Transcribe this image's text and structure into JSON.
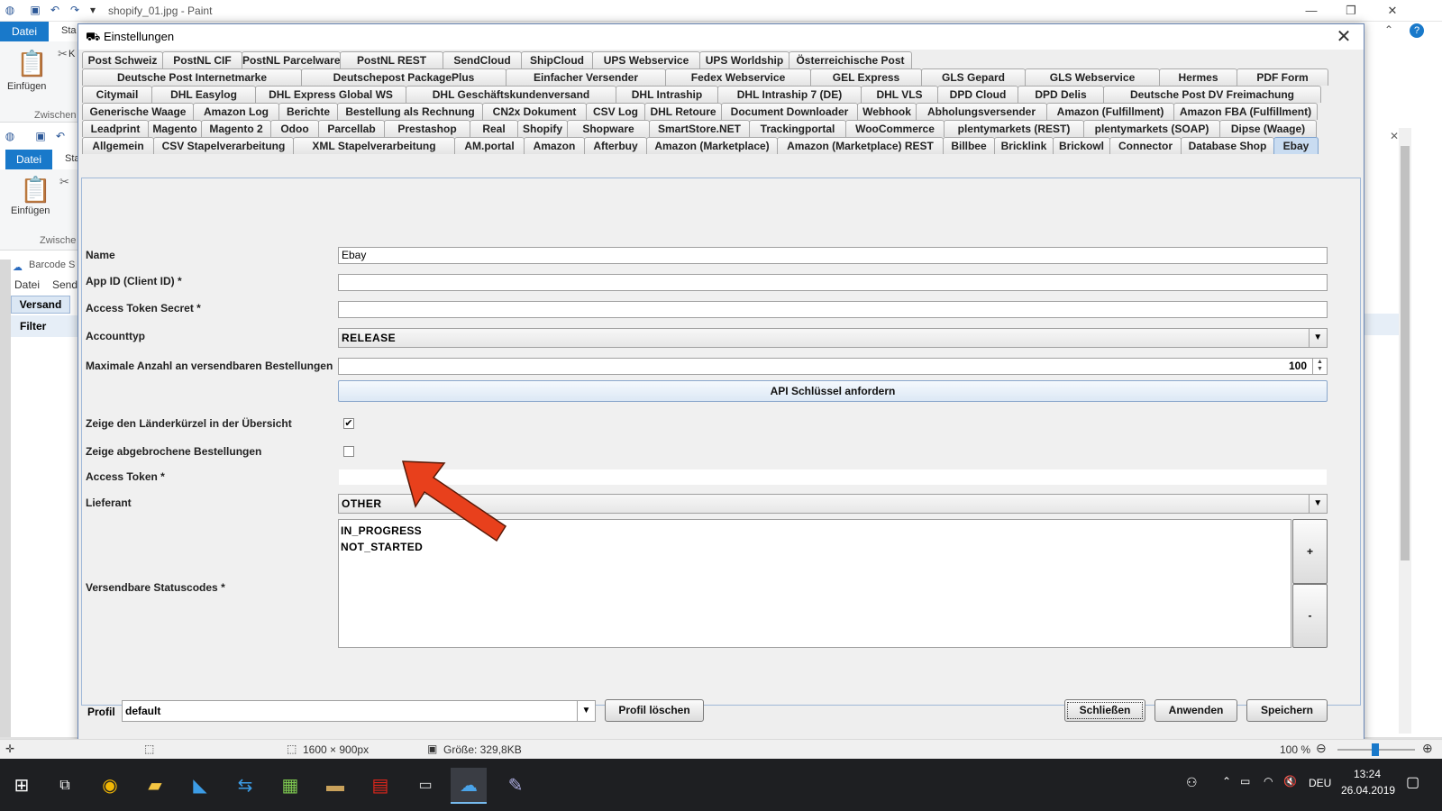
{
  "paint": {
    "title": "shopify_01.jpg - Paint",
    "file_tab": "Datei",
    "start_tab": "Sta",
    "paste_label": "Einfügen",
    "clipboard_label": "Zwischen",
    "clipboard_label2": "Zwische",
    "cut_abbrev": "K"
  },
  "barcode_app": {
    "title": "Barcode S",
    "menu": [
      "Datei",
      "Send"
    ],
    "tab_label": "Versand",
    "filter_label": "Filter",
    "column_fragment": "n"
  },
  "dialog": {
    "title": "Einstellungen",
    "tab_rows": [
      [
        "Post Schweiz",
        "PostNL CIF",
        "PostNL Parcelware",
        "PostNL REST",
        "SendCloud",
        "ShipCloud",
        "UPS Webservice",
        "UPS Worldship",
        "Österreichische Post"
      ],
      [
        "Deutsche Post Internetmarke",
        "Deutschepost PackagePlus",
        "Einfacher Versender",
        "Fedex Webservice",
        "GEL Express",
        "GLS Gepard",
        "GLS Webservice",
        "Hermes",
        "PDF Form"
      ],
      [
        "Citymail",
        "DHL Easylog",
        "DHL Express Global WS",
        "DHL Geschäftskundenversand",
        "DHL Intraship",
        "DHL Intraship 7 (DE)",
        "DHL VLS",
        "DPD Cloud",
        "DPD Delis",
        "Deutsche Post DV Freimachung"
      ],
      [
        "Generische Waage",
        "Amazon Log",
        "Berichte",
        "Bestellung als Rechnung",
        "CN2x Dokument",
        "CSV Log",
        "DHL Retoure",
        "Document Downloader",
        "Webhook",
        "Abholungsversender",
        "Amazon (Fulfillment)",
        "Amazon FBA (Fulfillment)"
      ],
      [
        "Leadprint",
        "Magento",
        "Magento 2",
        "Odoo",
        "Parcellab",
        "Prestashop",
        "Real",
        "Shopify",
        "Shopware",
        "SmartStore.NET",
        "Trackingportal",
        "WooCommerce",
        "plentymarkets (REST)",
        "plentymarkets (SOAP)",
        "Dipse (Waage)"
      ],
      [
        "Allgemein",
        "CSV Stapelverarbeitung",
        "XML Stapelverarbeitung",
        "AM.portal",
        "Amazon",
        "Afterbuy",
        "Amazon (Marketplace)",
        "Amazon (Marketplace) REST",
        "Billbee",
        "Bricklink",
        "Brickowl",
        "Connector",
        "Database Shop",
        "Ebay"
      ]
    ],
    "active_tab": "Ebay",
    "form": {
      "name_label": "Name",
      "name_value": "Ebay",
      "app_id_label": "App ID (Client ID) *",
      "app_id_value": "",
      "token_secret_label": "Access Token Secret *",
      "token_secret_value": "",
      "account_type_label": "Accounttyp",
      "account_type_value": "RELEASE",
      "max_orders_label": "Maximale Anzahl an versendbaren Bestellungen",
      "max_orders_value": "100",
      "api_key_button": "API Schlüssel anfordern",
      "show_country_label": "Zeige den Länderkürzel in der Übersicht",
      "show_country_checked": true,
      "show_cancelled_label": "Zeige abgebrochene Bestellungen",
      "show_cancelled_checked": false,
      "access_token_label": "Access Token *",
      "access_token_value": "",
      "supplier_label": "Lieferant",
      "supplier_value": "OTHER",
      "status_codes_label": "Versendbare Statuscodes *",
      "status_codes": [
        "IN_PROGRESS",
        "NOT_STARTED"
      ],
      "add_button": "+",
      "remove_button": "-"
    },
    "footer": {
      "profile_label": "Profil",
      "profile_value": "default",
      "delete_profile_button": "Profil löschen",
      "close_button": "Schließen",
      "apply_button": "Anwenden",
      "save_button": "Speichern"
    }
  },
  "status_bar": {
    "dimensions": "1600 × 900px",
    "size": "Größe: 329,8KB",
    "zoom": "100 %"
  },
  "taskbar": {
    "language": "DEU",
    "time": "13:24",
    "date": "26.04.2019"
  },
  "colors": {
    "arrow": "#e8401c",
    "active_tab": "#c9dcf1",
    "paint_accent": "#1979ca"
  }
}
